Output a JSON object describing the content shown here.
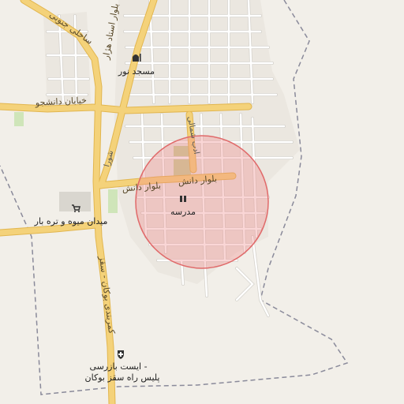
{
  "map": {
    "road_labels": {
      "boulevard_danesh_1": "بلوار دانش",
      "boulevard_danesh_2": "بلوار دانش",
      "sahili_jonubi": "ساحلی جنوبی",
      "boulevard_ostad_hazhar": "بلوار استاد هژار",
      "khiaban_daneshjoo": "خیابان دانشجو",
      "kamarbandi_saqqez": "کمربندی بوکان - سقز",
      "adab_shomali": "ادب شمالی",
      "shora": "شورا"
    },
    "pois": {
      "mosque": "مسجد نور",
      "school": "مدرسه",
      "fruit_market": "میدان میوه و تره بار",
      "police_station_line1": "ایست بازرسی -",
      "police_station_line2": "پلیس راه سقز بوکان"
    },
    "colors": {
      "background": "#f2efe9",
      "major_road": "#f4d27a",
      "major_road_casing": "#e2b64f",
      "minor_road": "#ffffff",
      "minor_road_casing": "#d6d3cd",
      "boundary": "#8a8a9a",
      "highlight_fill": "#f08a8a",
      "highlight_stroke": "#e06a6a",
      "park": "#cfe5b9"
    },
    "icons": {
      "mosque": "mosque-icon",
      "school": "school-icon",
      "market": "shopping-cart-icon",
      "police": "police-icon"
    }
  }
}
